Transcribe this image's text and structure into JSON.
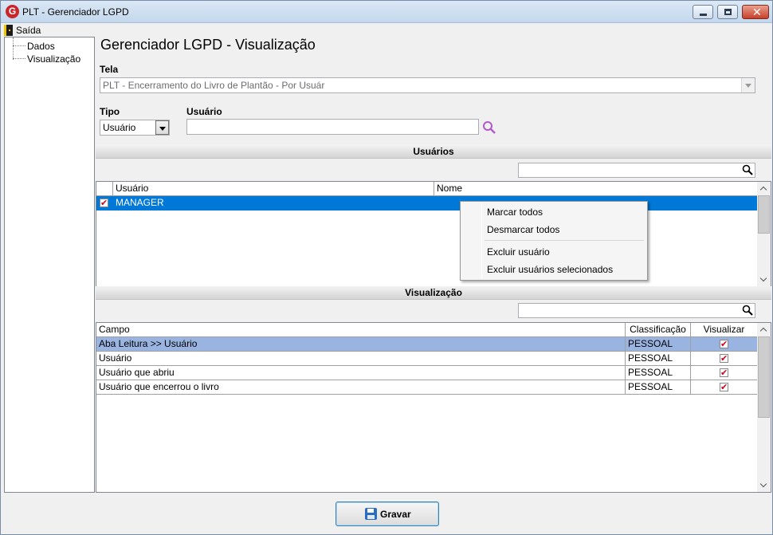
{
  "window": {
    "title": "PLT - Gerenciador LGPD",
    "app_icon_letter": "G"
  },
  "menubar": {
    "exit_label": "Saída"
  },
  "tree": {
    "items": [
      "Dados",
      "Visualização"
    ]
  },
  "main": {
    "title": "Gerenciador LGPD - Visualização",
    "tela_label": "Tela",
    "tela_value": "PLT - Encerramento do Livro de Plantão - Por Usuár",
    "tipo_label": "Tipo",
    "tipo_value": "Usuário",
    "usuario_label": "Usuário",
    "usuario_value": ""
  },
  "usuarios_section": {
    "header": "Usuários",
    "filter_value": "",
    "columns": [
      "Usuário",
      "Nome"
    ],
    "rows": [
      {
        "checked": true,
        "usuario": "MANAGER",
        "nome": ""
      }
    ]
  },
  "context_menu": {
    "items": [
      "Marcar todos",
      "Desmarcar todos",
      "Excluir usuário",
      "Excluir usuários selecionados"
    ]
  },
  "visualizacao_section": {
    "header": "Visualização",
    "filter_value": "",
    "columns": [
      "Campo",
      "Classificação",
      "Visualizar"
    ],
    "rows": [
      {
        "campo": "Aba Leitura >> Usuário",
        "classificacao": "PESSOAL",
        "visualizar": true
      },
      {
        "campo": "Usuário",
        "classificacao": "PESSOAL",
        "visualizar": true
      },
      {
        "campo": "Usuário que abriu",
        "classificacao": "PESSOAL",
        "visualizar": true
      },
      {
        "campo": "Usuário que encerrou o livro",
        "classificacao": "PESSOAL",
        "visualizar": true
      }
    ]
  },
  "footer": {
    "save_label": "Gravar"
  },
  "colors": {
    "selection": "#0078d7",
    "selection_light": "#99b4e1",
    "check": "#d0021b"
  }
}
